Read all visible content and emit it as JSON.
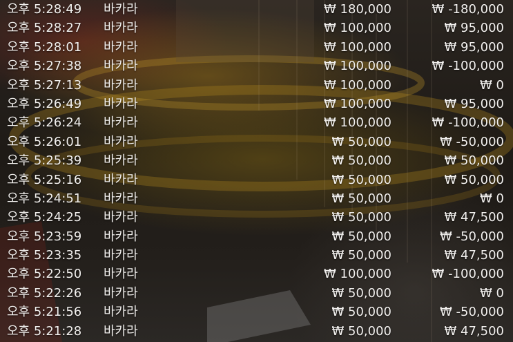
{
  "history": {
    "rows": [
      {
        "time": "오후 5:28:49",
        "game": "바카라",
        "bet": "₩ 180,000",
        "result": "₩ -180,000"
      },
      {
        "time": "오후 5:28:27",
        "game": "바카라",
        "bet": "₩ 100,000",
        "result": "₩ 95,000"
      },
      {
        "time": "오후 5:28:01",
        "game": "바카라",
        "bet": "₩ 100,000",
        "result": "₩ 95,000"
      },
      {
        "time": "오후 5:27:38",
        "game": "바카라",
        "bet": "₩ 100,000",
        "result": "₩ -100,000"
      },
      {
        "time": "오후 5:27:13",
        "game": "바카라",
        "bet": "₩ 100,000",
        "result": "₩ 0"
      },
      {
        "time": "오후 5:26:49",
        "game": "바카라",
        "bet": "₩ 100,000",
        "result": "₩ 95,000"
      },
      {
        "time": "오후 5:26:24",
        "game": "바카라",
        "bet": "₩ 100,000",
        "result": "₩ -100,000"
      },
      {
        "time": "오후 5:26:01",
        "game": "바카라",
        "bet": "₩ 50,000",
        "result": "₩ -50,000"
      },
      {
        "time": "오후 5:25:39",
        "game": "바카라",
        "bet": "₩ 50,000",
        "result": "₩ 50,000"
      },
      {
        "time": "오후 5:25:16",
        "game": "바카라",
        "bet": "₩ 50,000",
        "result": "₩ 50,000"
      },
      {
        "time": "오후 5:24:51",
        "game": "바카라",
        "bet": "₩ 50,000",
        "result": "₩ 0"
      },
      {
        "time": "오후 5:24:25",
        "game": "바카라",
        "bet": "₩ 50,000",
        "result": "₩ 47,500"
      },
      {
        "time": "오후 5:23:59",
        "game": "바카라",
        "bet": "₩ 50,000",
        "result": "₩ -50,000"
      },
      {
        "time": "오후 5:23:35",
        "game": "바카라",
        "bet": "₩ 50,000",
        "result": "₩ 47,500"
      },
      {
        "time": "오후 5:22:50",
        "game": "바카라",
        "bet": "₩ 100,000",
        "result": "₩ -100,000"
      },
      {
        "time": "오후 5:22:26",
        "game": "바카라",
        "bet": "₩ 50,000",
        "result": "₩ 0"
      },
      {
        "time": "오후 5:21:56",
        "game": "바카라",
        "bet": "₩ 50,000",
        "result": "₩ -50,000"
      },
      {
        "time": "오후 5:21:28",
        "game": "바카라",
        "bet": "₩ 50,000",
        "result": "₩ 47,500"
      }
    ]
  }
}
